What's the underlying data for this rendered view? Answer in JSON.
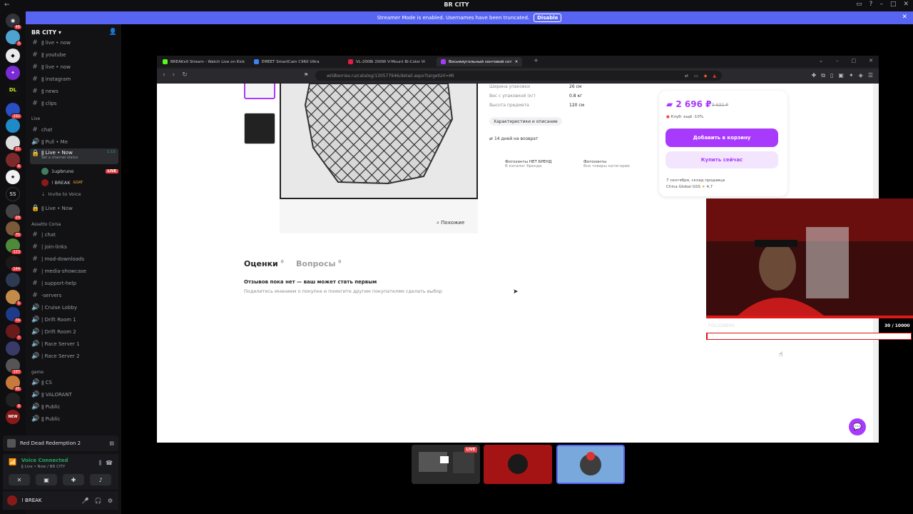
{
  "window": {
    "title": "BR CITY"
  },
  "banner": {
    "text": "Streamer Mode is enabled. Usernames have been truncated.",
    "disable_label": "Disable"
  },
  "server_rail": {
    "badges": [
      "48",
      "3",
      "292",
      "15",
      "6",
      "29",
      "70",
      "123",
      "144",
      "5",
      "74",
      "7",
      "197",
      "95",
      "9"
    ],
    "labels": {
      "dl": "DL",
      "ss": "SS",
      "new": "NEW"
    }
  },
  "server": {
    "name": "BR CITY"
  },
  "channels": [
    {
      "name": "ǁ live • now",
      "type": "text"
    },
    {
      "name": "ǁ youtube",
      "type": "text"
    },
    {
      "name": "ǁ live • now",
      "type": "text"
    },
    {
      "name": "ǁ instagram",
      "type": "text"
    },
    {
      "name": "ǁ news",
      "type": "text"
    },
    {
      "name": "ǁ clips",
      "type": "text"
    }
  ],
  "categories": {
    "live": "Live",
    "assetto": "Assetto Corsa",
    "game": "game"
  },
  "live_channels": [
    {
      "name": "chat",
      "type": "text"
    },
    {
      "name": "ǁ Pull • Me",
      "type": "voice"
    }
  ],
  "selected_voice": {
    "name": "ǁ Live • Now",
    "timer": "1:15",
    "status_hint": "Set a channel status"
  },
  "voice_users": [
    {
      "name": "1upbruno",
      "badge": "LIVE"
    },
    {
      "name": "! BREAK",
      "badge": "GOAT"
    }
  ],
  "invite_label": "Invite to Voice",
  "locked_channel": "ǁ Live • Now",
  "assetto_channels": [
    {
      "name": "| chat",
      "type": "text"
    },
    {
      "name": "| join-links",
      "type": "text"
    },
    {
      "name": "| mod-downloads",
      "type": "text"
    },
    {
      "name": "| media-showcase",
      "type": "text"
    },
    {
      "name": "| support-help",
      "type": "text"
    },
    {
      "name": "-servers",
      "type": "text"
    },
    {
      "name": "| Cruise Lobby",
      "type": "voice"
    },
    {
      "name": "| Drift Room 1",
      "type": "voice"
    },
    {
      "name": "| Drift Room 2",
      "type": "voice"
    },
    {
      "name": "| Race Server 1",
      "type": "voice"
    },
    {
      "name": "| Race Server 2",
      "type": "voice"
    }
  ],
  "game_channels": [
    {
      "name": "ǁ CS",
      "type": "voice"
    },
    {
      "name": "ǁ VALORANT",
      "type": "voice"
    },
    {
      "name": "ǁ Public",
      "type": "voice"
    },
    {
      "name": "ǁ Public",
      "type": "voice"
    }
  ],
  "now_playing": "Red Dead Redemption 2",
  "voice_panel": {
    "title": "Voice Connected",
    "sub": "ǁ Live • Now / BR CITY"
  },
  "user_panel": {
    "name": "! BREAK"
  },
  "browser": {
    "tabs": [
      "BREAKx0 Stream - Watch Live on Kick",
      "EMEET SmartCam C960 Ultra",
      "VL-200Bi 200W V-Mount Bi-Color Vi",
      "Восьмиугольный зонтовой сот"
    ],
    "url": "wildberries.ru/catalog/130577946/detail.aspx?targetUrl=MI"
  },
  "product": {
    "similar_label": "Похожие",
    "specs": [
      {
        "label": "Ширина упаковки",
        "value": "26 см"
      },
      {
        "label": "Вес с упаковкой (кг)",
        "value": "0.8 кг"
      },
      {
        "label": "Высота предмета",
        "value": "120 см"
      }
    ],
    "chip": "Характеристики и описание",
    "returns": "14 дней на возврат",
    "brand": {
      "title": "Фотозонты НЕТ БРЕНД",
      "sub": "В каталог бренда"
    },
    "category": {
      "title": "Фотозонты",
      "sub": "Все товары категории"
    },
    "price": "2 696 ₽",
    "old_price": "9 631 ₽",
    "club": "Клуб: ещё -10%",
    "add_to_cart": "Добавить в корзину",
    "buy_now": "Купить сейчас",
    "delivery_date": "7 сентября, склад продавца",
    "seller": "China Global GSS",
    "rating": "4,7"
  },
  "reviews": {
    "tab_reviews": "Оценки",
    "tab_reviews_count": "0",
    "tab_questions": "Вопросы",
    "tab_questions_count": "0",
    "empty_title": "Отзывов пока нет — ваш может стать первым",
    "empty_sub": "Поделитесь мнением о покупке и помогите другим покупателям сделать выбор"
  },
  "overlay": {
    "followers_label": "FOLLOWERS",
    "followers_count": "30 / 10000",
    "followers_progress": 0.003
  },
  "streams": {
    "live_label": "LIVE"
  },
  "colors": {
    "accent": "#a73afd",
    "discord_blurple": "#5865f2",
    "live_red": "#ed4245",
    "voice_green": "#23a55a"
  }
}
